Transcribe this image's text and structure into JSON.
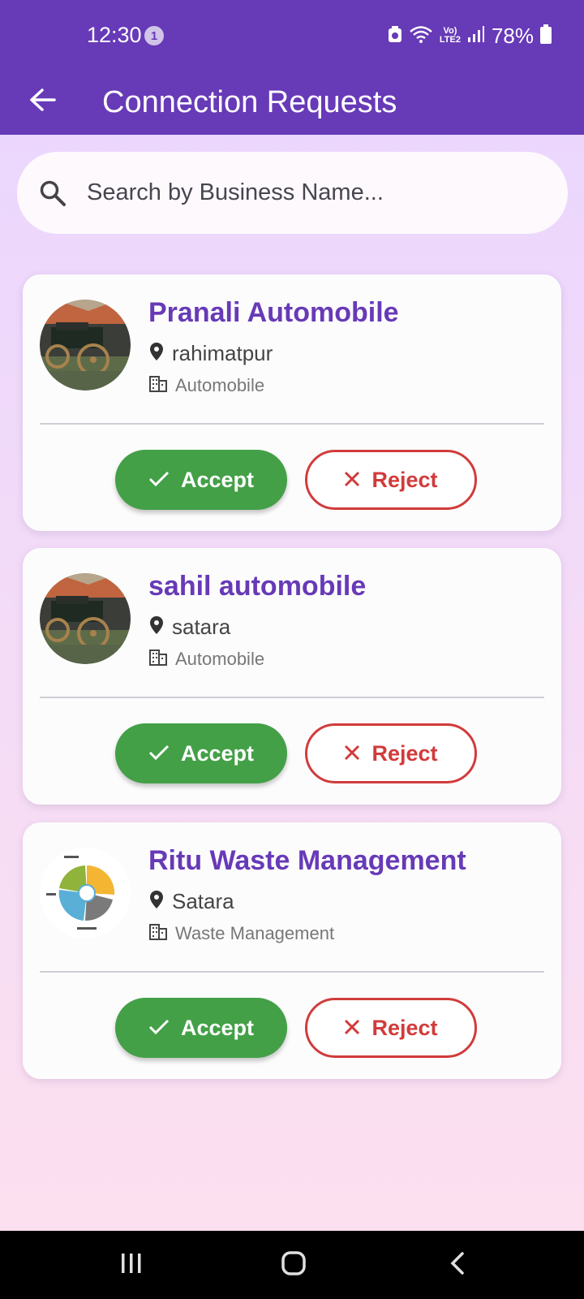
{
  "status": {
    "time": "12:30",
    "notification_count": "1",
    "network_label_top": "Vo)",
    "network_label_bottom": "LTE2",
    "battery": "78%"
  },
  "appbar": {
    "title": "Connection Requests",
    "back_icon": "arrow-left-icon"
  },
  "search": {
    "placeholder": "Search by Business Name...",
    "value": "",
    "icon": "search-icon"
  },
  "requests": [
    {
      "name": "Pranali Automobile",
      "location": "rahimatpur",
      "category": "Automobile",
      "avatar": "vintage-car-photo"
    },
    {
      "name": "sahil automobile",
      "location": "satara",
      "category": "Automobile",
      "avatar": "vintage-car-photo"
    },
    {
      "name": "Ritu Waste Management",
      "location": "Satara",
      "category": "Waste Management",
      "avatar": "waste-cycle-diagram"
    }
  ],
  "actions": {
    "accept_label": "Accept",
    "reject_label": "Reject"
  },
  "colors": {
    "primary": "#673ab7",
    "accept": "#43a047",
    "reject": "#d13b3b"
  },
  "navbar": {
    "icons": [
      "recent-apps-icon",
      "home-icon",
      "back-icon"
    ]
  }
}
